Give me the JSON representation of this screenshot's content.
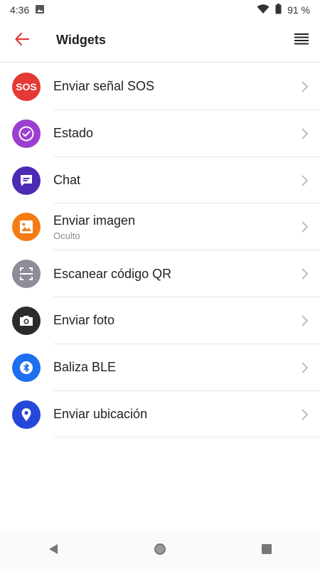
{
  "status": {
    "time": "4:36",
    "battery": "91 %",
    "icons": [
      "image-notification-icon",
      "wifi-icon",
      "battery-icon"
    ]
  },
  "appbar": {
    "title": "Widgets",
    "back_icon": "arrow-left-icon",
    "menu_icon": "list-menu-icon",
    "accent": "#e53935"
  },
  "items": [
    {
      "label": "Enviar señal SOS",
      "sub": "",
      "icon": "sos-icon",
      "icon_text": "SOS",
      "color": "#e53935"
    },
    {
      "label": "Estado",
      "sub": "",
      "icon": "check-circle-icon",
      "color": "#9c3fd0"
    },
    {
      "label": "Chat",
      "sub": "",
      "icon": "chat-icon",
      "color": "#4b2bb5"
    },
    {
      "label": "Enviar imagen",
      "sub": "Oculto",
      "icon": "image-icon",
      "color": "#f57c14"
    },
    {
      "label": "Escanear código QR",
      "sub": "",
      "icon": "qr-scan-icon",
      "color": "#8f8c99"
    },
    {
      "label": "Enviar foto",
      "sub": "",
      "icon": "camera-icon",
      "color": "#2b2b2b"
    },
    {
      "label": "Baliza BLE",
      "sub": "",
      "icon": "bluetooth-icon",
      "color": "#1e6ef0"
    },
    {
      "label": "Enviar ubicación",
      "sub": "",
      "icon": "location-pin-icon",
      "color": "#2648d8"
    }
  ],
  "navbar": {
    "icons": [
      "back-triangle-icon",
      "home-circle-icon",
      "recents-square-icon"
    ]
  }
}
